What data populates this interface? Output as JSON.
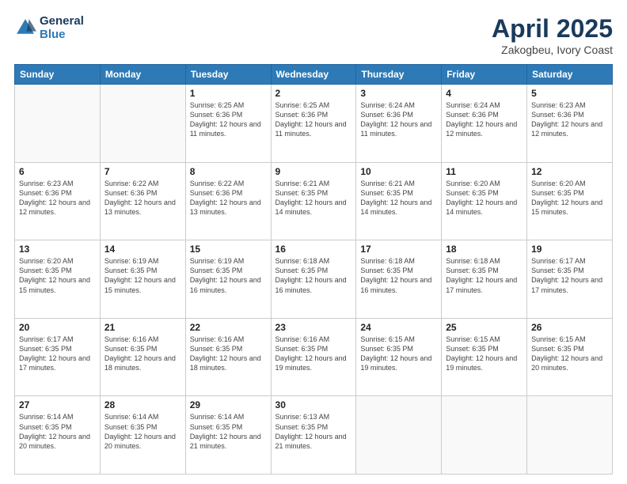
{
  "logo": {
    "general": "General",
    "blue": "Blue"
  },
  "title": "April 2025",
  "subtitle": "Zakogbeu, Ivory Coast",
  "days_of_week": [
    "Sunday",
    "Monday",
    "Tuesday",
    "Wednesday",
    "Thursday",
    "Friday",
    "Saturday"
  ],
  "weeks": [
    [
      {
        "num": "",
        "info": "",
        "empty": true
      },
      {
        "num": "",
        "info": "",
        "empty": true
      },
      {
        "num": "1",
        "info": "Sunrise: 6:25 AM\nSunset: 6:36 PM\nDaylight: 12 hours and 11 minutes."
      },
      {
        "num": "2",
        "info": "Sunrise: 6:25 AM\nSunset: 6:36 PM\nDaylight: 12 hours and 11 minutes."
      },
      {
        "num": "3",
        "info": "Sunrise: 6:24 AM\nSunset: 6:36 PM\nDaylight: 12 hours and 11 minutes."
      },
      {
        "num": "4",
        "info": "Sunrise: 6:24 AM\nSunset: 6:36 PM\nDaylight: 12 hours and 12 minutes."
      },
      {
        "num": "5",
        "info": "Sunrise: 6:23 AM\nSunset: 6:36 PM\nDaylight: 12 hours and 12 minutes."
      }
    ],
    [
      {
        "num": "6",
        "info": "Sunrise: 6:23 AM\nSunset: 6:36 PM\nDaylight: 12 hours and 12 minutes."
      },
      {
        "num": "7",
        "info": "Sunrise: 6:22 AM\nSunset: 6:36 PM\nDaylight: 12 hours and 13 minutes."
      },
      {
        "num": "8",
        "info": "Sunrise: 6:22 AM\nSunset: 6:36 PM\nDaylight: 12 hours and 13 minutes."
      },
      {
        "num": "9",
        "info": "Sunrise: 6:21 AM\nSunset: 6:35 PM\nDaylight: 12 hours and 14 minutes."
      },
      {
        "num": "10",
        "info": "Sunrise: 6:21 AM\nSunset: 6:35 PM\nDaylight: 12 hours and 14 minutes."
      },
      {
        "num": "11",
        "info": "Sunrise: 6:20 AM\nSunset: 6:35 PM\nDaylight: 12 hours and 14 minutes."
      },
      {
        "num": "12",
        "info": "Sunrise: 6:20 AM\nSunset: 6:35 PM\nDaylight: 12 hours and 15 minutes."
      }
    ],
    [
      {
        "num": "13",
        "info": "Sunrise: 6:20 AM\nSunset: 6:35 PM\nDaylight: 12 hours and 15 minutes."
      },
      {
        "num": "14",
        "info": "Sunrise: 6:19 AM\nSunset: 6:35 PM\nDaylight: 12 hours and 15 minutes."
      },
      {
        "num": "15",
        "info": "Sunrise: 6:19 AM\nSunset: 6:35 PM\nDaylight: 12 hours and 16 minutes."
      },
      {
        "num": "16",
        "info": "Sunrise: 6:18 AM\nSunset: 6:35 PM\nDaylight: 12 hours and 16 minutes."
      },
      {
        "num": "17",
        "info": "Sunrise: 6:18 AM\nSunset: 6:35 PM\nDaylight: 12 hours and 16 minutes."
      },
      {
        "num": "18",
        "info": "Sunrise: 6:18 AM\nSunset: 6:35 PM\nDaylight: 12 hours and 17 minutes."
      },
      {
        "num": "19",
        "info": "Sunrise: 6:17 AM\nSunset: 6:35 PM\nDaylight: 12 hours and 17 minutes."
      }
    ],
    [
      {
        "num": "20",
        "info": "Sunrise: 6:17 AM\nSunset: 6:35 PM\nDaylight: 12 hours and 17 minutes."
      },
      {
        "num": "21",
        "info": "Sunrise: 6:16 AM\nSunset: 6:35 PM\nDaylight: 12 hours and 18 minutes."
      },
      {
        "num": "22",
        "info": "Sunrise: 6:16 AM\nSunset: 6:35 PM\nDaylight: 12 hours and 18 minutes."
      },
      {
        "num": "23",
        "info": "Sunrise: 6:16 AM\nSunset: 6:35 PM\nDaylight: 12 hours and 19 minutes."
      },
      {
        "num": "24",
        "info": "Sunrise: 6:15 AM\nSunset: 6:35 PM\nDaylight: 12 hours and 19 minutes."
      },
      {
        "num": "25",
        "info": "Sunrise: 6:15 AM\nSunset: 6:35 PM\nDaylight: 12 hours and 19 minutes."
      },
      {
        "num": "26",
        "info": "Sunrise: 6:15 AM\nSunset: 6:35 PM\nDaylight: 12 hours and 20 minutes."
      }
    ],
    [
      {
        "num": "27",
        "info": "Sunrise: 6:14 AM\nSunset: 6:35 PM\nDaylight: 12 hours and 20 minutes."
      },
      {
        "num": "28",
        "info": "Sunrise: 6:14 AM\nSunset: 6:35 PM\nDaylight: 12 hours and 20 minutes."
      },
      {
        "num": "29",
        "info": "Sunrise: 6:14 AM\nSunset: 6:35 PM\nDaylight: 12 hours and 21 minutes."
      },
      {
        "num": "30",
        "info": "Sunrise: 6:13 AM\nSunset: 6:35 PM\nDaylight: 12 hours and 21 minutes."
      },
      {
        "num": "",
        "info": "",
        "empty": true
      },
      {
        "num": "",
        "info": "",
        "empty": true
      },
      {
        "num": "",
        "info": "",
        "empty": true
      }
    ]
  ]
}
